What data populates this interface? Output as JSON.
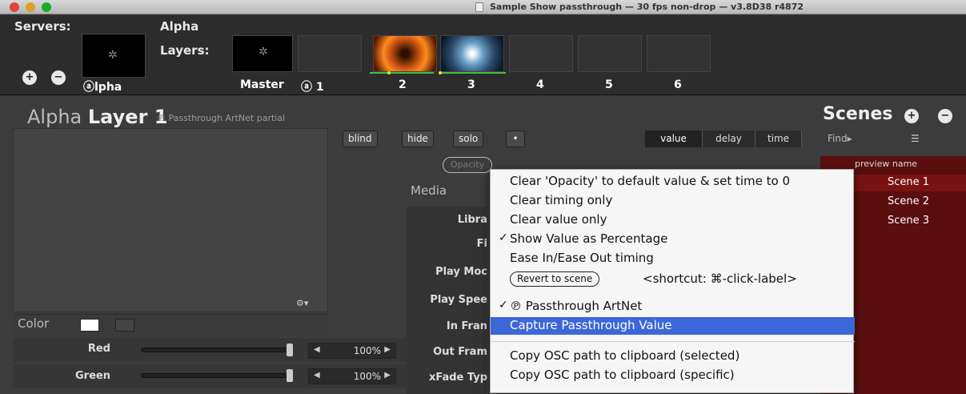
{
  "window": {
    "title": "Sample Show passthrough  —  30 fps non-drop  —  v3.8D38 r4872"
  },
  "serverbar": {
    "servers_label": "Servers:",
    "alpha_label": "Alpha",
    "layers_label": "Layers:",
    "add_icon": "plus-icon",
    "remove_icon": "minus-icon",
    "servers": [
      {
        "label": "ⓐlpha",
        "selected": true
      }
    ],
    "layers": [
      {
        "label": "Master"
      },
      {
        "label": "ⓐ  1",
        "selected": true
      },
      {
        "label": "2"
      },
      {
        "label": "3"
      },
      {
        "label": "4"
      },
      {
        "label": "5"
      },
      {
        "label": "6"
      }
    ]
  },
  "layer": {
    "heading_prefix": "Alpha",
    "heading_main": "Layer 1",
    "subtitle": "℗ Passthrough ArtNet partial",
    "buttons": [
      "blind",
      "hide",
      "solo",
      "•"
    ],
    "mode_tabs": [
      "value",
      "delay",
      "time"
    ],
    "active_mode": "value",
    "opacity_label": "Opacity",
    "media_label": "Media",
    "media_rows": [
      "Libra",
      "Fi",
      "Play Moc",
      "Play Spee",
      "In Fran",
      "Out Fram",
      "xFade Typ"
    ],
    "color_label": "Color",
    "params": [
      {
        "name": "Red",
        "value": "100%",
        "level": 1.0
      },
      {
        "name": "Green",
        "value": "100%",
        "level": 1.0
      }
    ],
    "swatch_color": "#ffffff"
  },
  "scenes": {
    "title": "Scenes",
    "find_label": "Find▸",
    "column_header": "preview name",
    "items": [
      {
        "name": "Scene 1",
        "selected": true
      },
      {
        "name": "Scene 2"
      },
      {
        "name": "Scene 3"
      }
    ]
  },
  "context_menu": {
    "items": [
      {
        "label": "Clear 'Opacity' to default value & set time to 0"
      },
      {
        "label": "Clear timing only"
      },
      {
        "label": "Clear value only"
      },
      {
        "label": "Show Value as Percentage",
        "checked": true
      },
      {
        "label": "Ease In/Ease Out timing"
      },
      {
        "label": "Revert to scene",
        "shortcut": "<shortcut: ⌘-click-label>"
      },
      {
        "label": "℗ Passthrough ArtNet",
        "checked": true
      },
      {
        "label": "Capture Passthrough Value",
        "highlighted": true
      },
      {
        "label": "Copy OSC path to clipboard (selected)"
      },
      {
        "label": "Copy OSC path to clipboard (specific)"
      }
    ]
  },
  "colors": {
    "accent_highlight": "#3b67d8",
    "scene_selected": "#7a1212",
    "progress_green": "#3fc23f"
  }
}
